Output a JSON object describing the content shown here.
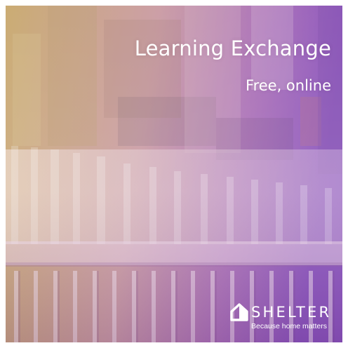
{
  "promo": {
    "title": "Learning Exchange",
    "subtitle": "Free, online"
  },
  "brand": {
    "name": "SHELTER",
    "tagline": "Because home matters",
    "logo_icon": "shelter-roof-logo-icon"
  },
  "colors": {
    "overlay_left": "#c9a86a",
    "overlay_mid": "#c48fa6",
    "overlay_right": "#8a4fb8",
    "text": "#ffffff"
  }
}
